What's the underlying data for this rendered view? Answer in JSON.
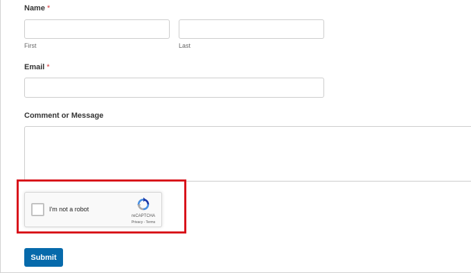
{
  "form": {
    "name": {
      "label": "Name",
      "required_mark": "*",
      "first": {
        "value": "",
        "sublabel": "First"
      },
      "last": {
        "value": "",
        "sublabel": "Last"
      }
    },
    "email": {
      "label": "Email",
      "required_mark": "*",
      "value": ""
    },
    "comment": {
      "label": "Comment or Message",
      "value": ""
    },
    "recaptcha": {
      "checkbox_label": "I'm not a robot",
      "brand": "reCAPTCHA",
      "links": "Privacy - Terms",
      "checked": false
    },
    "submit_label": "Submit"
  },
  "colors": {
    "required": "#d63638",
    "submit_bg": "#066aab",
    "highlight_border": "#d8101a"
  }
}
